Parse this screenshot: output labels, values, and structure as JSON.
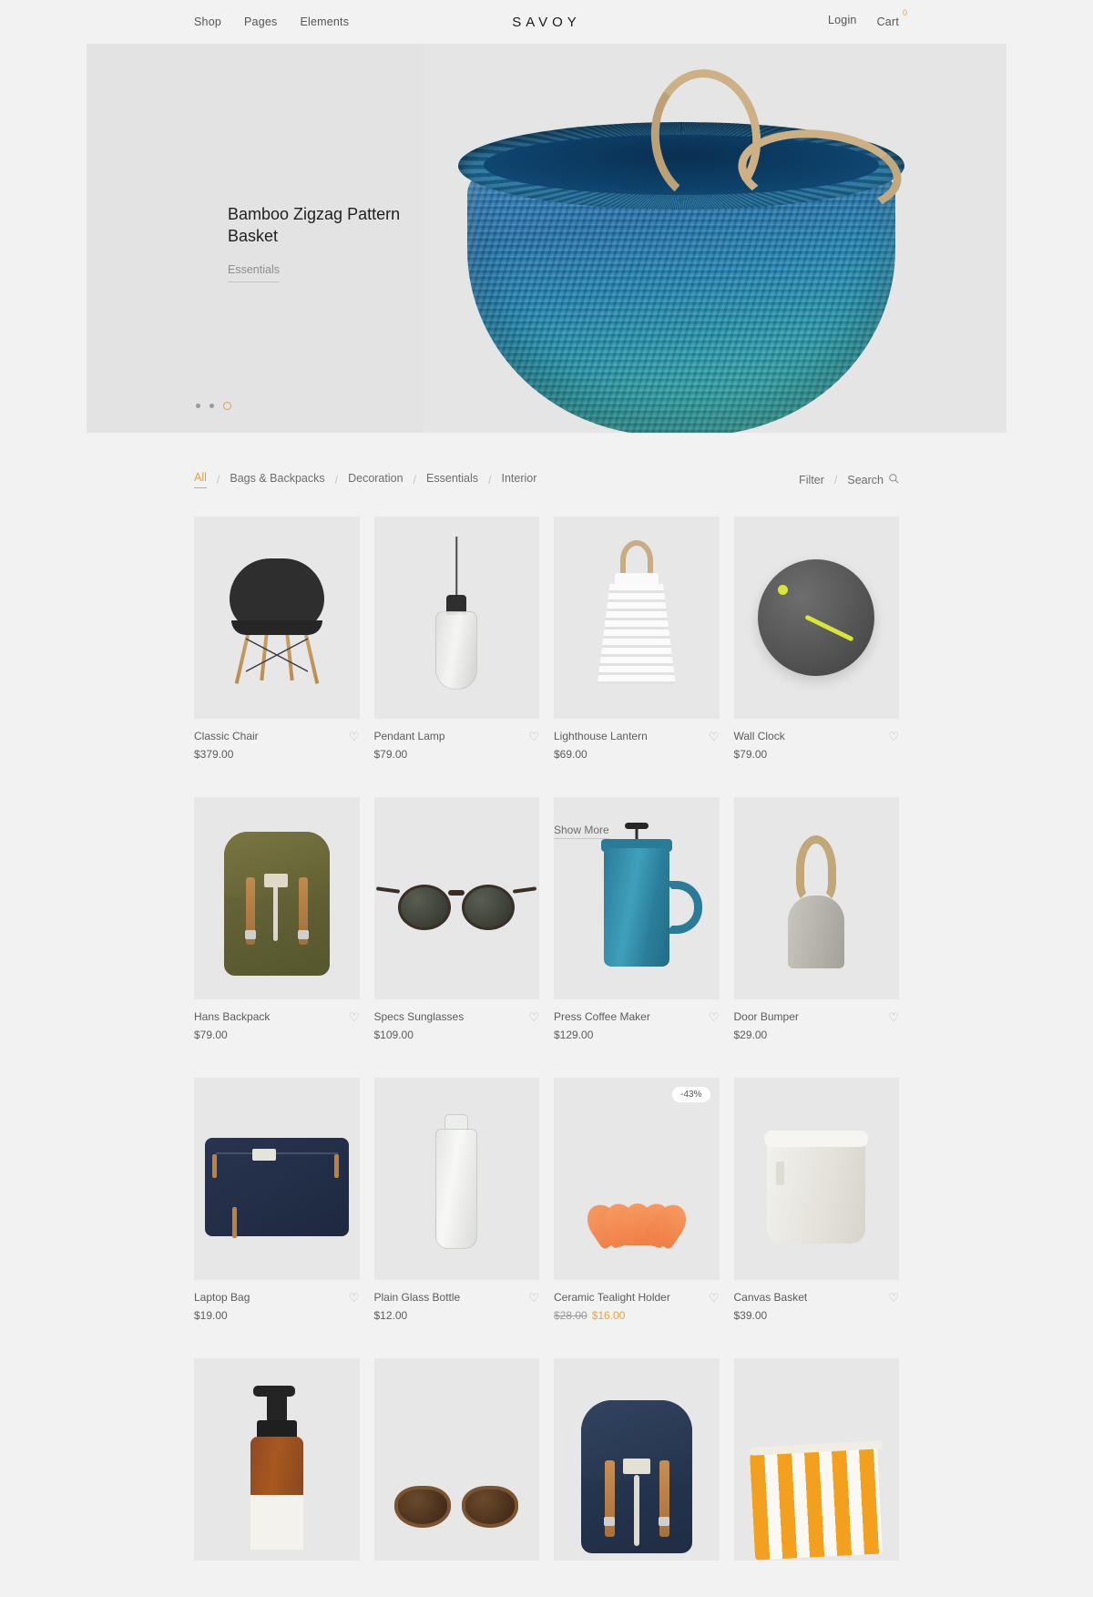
{
  "header": {
    "brand": "SAVOY",
    "nav_left": [
      {
        "label": "Shop"
      },
      {
        "label": "Pages"
      },
      {
        "label": "Elements"
      }
    ],
    "login_label": "Login",
    "cart_label": "Cart",
    "cart_count": "0"
  },
  "hero": {
    "title": "Bamboo Zigzag Pattern Basket",
    "category": "Essentials",
    "slides_total": 3,
    "active_slide": 3
  },
  "filter_bar": {
    "categories": [
      {
        "label": "All",
        "active": true
      },
      {
        "label": "Bags & Backpacks",
        "active": false
      },
      {
        "label": "Decoration",
        "active": false
      },
      {
        "label": "Essentials",
        "active": false
      },
      {
        "label": "Interior",
        "active": false
      }
    ],
    "separator": "/",
    "filter_label": "Filter",
    "search_label": "Search"
  },
  "products": [
    {
      "name": "Classic Chair",
      "price": "$379.00",
      "old_price": null,
      "sale_price": null,
      "badge": null,
      "wishlist_icon": "heart-icon",
      "art": "chair"
    },
    {
      "name": "Pendant Lamp",
      "price": "$79.00",
      "old_price": null,
      "sale_price": null,
      "badge": null,
      "wishlist_icon": "heart-icon",
      "art": "lamp"
    },
    {
      "name": "Lighthouse Lantern",
      "price": "$69.00",
      "old_price": null,
      "sale_price": null,
      "badge": null,
      "wishlist_icon": "heart-icon",
      "art": "lantern"
    },
    {
      "name": "Wall Clock",
      "price": "$79.00",
      "old_price": null,
      "sale_price": null,
      "badge": null,
      "wishlist_icon": "heart-icon",
      "art": "clock"
    },
    {
      "name": "Hans Backpack",
      "price": "$79.00",
      "old_price": null,
      "sale_price": null,
      "badge": null,
      "wishlist_icon": "heart-icon",
      "art": "olive-backpack"
    },
    {
      "name": "Specs Sunglasses",
      "price": "$109.00",
      "old_price": null,
      "sale_price": null,
      "badge": null,
      "wishlist_icon": "heart-icon",
      "art": "sunglasses"
    },
    {
      "name": "Press Coffee Maker",
      "price": "$129.00",
      "old_price": null,
      "sale_price": null,
      "badge": null,
      "wishlist_icon": "heart-icon",
      "art": "coffee-maker",
      "overlay_label": "Show More"
    },
    {
      "name": "Door Bumper",
      "price": "$29.00",
      "old_price": null,
      "sale_price": null,
      "badge": null,
      "wishlist_icon": "heart-icon",
      "art": "door-bumper"
    },
    {
      "name": "Laptop Bag",
      "price": "$19.00",
      "old_price": null,
      "sale_price": null,
      "badge": null,
      "wishlist_icon": "heart-icon",
      "art": "laptop-bag"
    },
    {
      "name": "Plain Glass Bottle",
      "price": "$12.00",
      "old_price": null,
      "sale_price": null,
      "badge": null,
      "wishlist_icon": "heart-icon",
      "art": "glass-bottle"
    },
    {
      "name": "Ceramic Tealight Holder",
      "price": null,
      "old_price": "$28.00",
      "sale_price": "$16.00",
      "badge": "-43%",
      "wishlist_icon": "heart-icon",
      "art": "tealight"
    },
    {
      "name": "Canvas Basket",
      "price": "$39.00",
      "old_price": null,
      "sale_price": null,
      "badge": null,
      "wishlist_icon": "heart-icon",
      "art": "canvas-basket"
    },
    {
      "name": null,
      "price": null,
      "old_price": null,
      "sale_price": null,
      "badge": null,
      "wishlist_icon": "heart-icon",
      "art": "soap-bottle"
    },
    {
      "name": null,
      "price": null,
      "old_price": null,
      "sale_price": null,
      "badge": null,
      "wishlist_icon": "heart-icon",
      "art": "tortoise-sunglasses"
    },
    {
      "name": null,
      "price": null,
      "old_price": null,
      "sale_price": null,
      "badge": null,
      "wishlist_icon": "heart-icon",
      "art": "navy-backpack"
    },
    {
      "name": null,
      "price": null,
      "old_price": null,
      "sale_price": null,
      "badge": null,
      "wishlist_icon": "heart-icon",
      "art": "striped-pouch"
    }
  ],
  "colors": {
    "accent": "#e8a33d",
    "page_bg": "#f2f2f2",
    "tile_bg": "#e7e7e7",
    "text": "#5c5c5c"
  },
  "icons": {
    "heart": "♡",
    "search": "search-icon"
  }
}
